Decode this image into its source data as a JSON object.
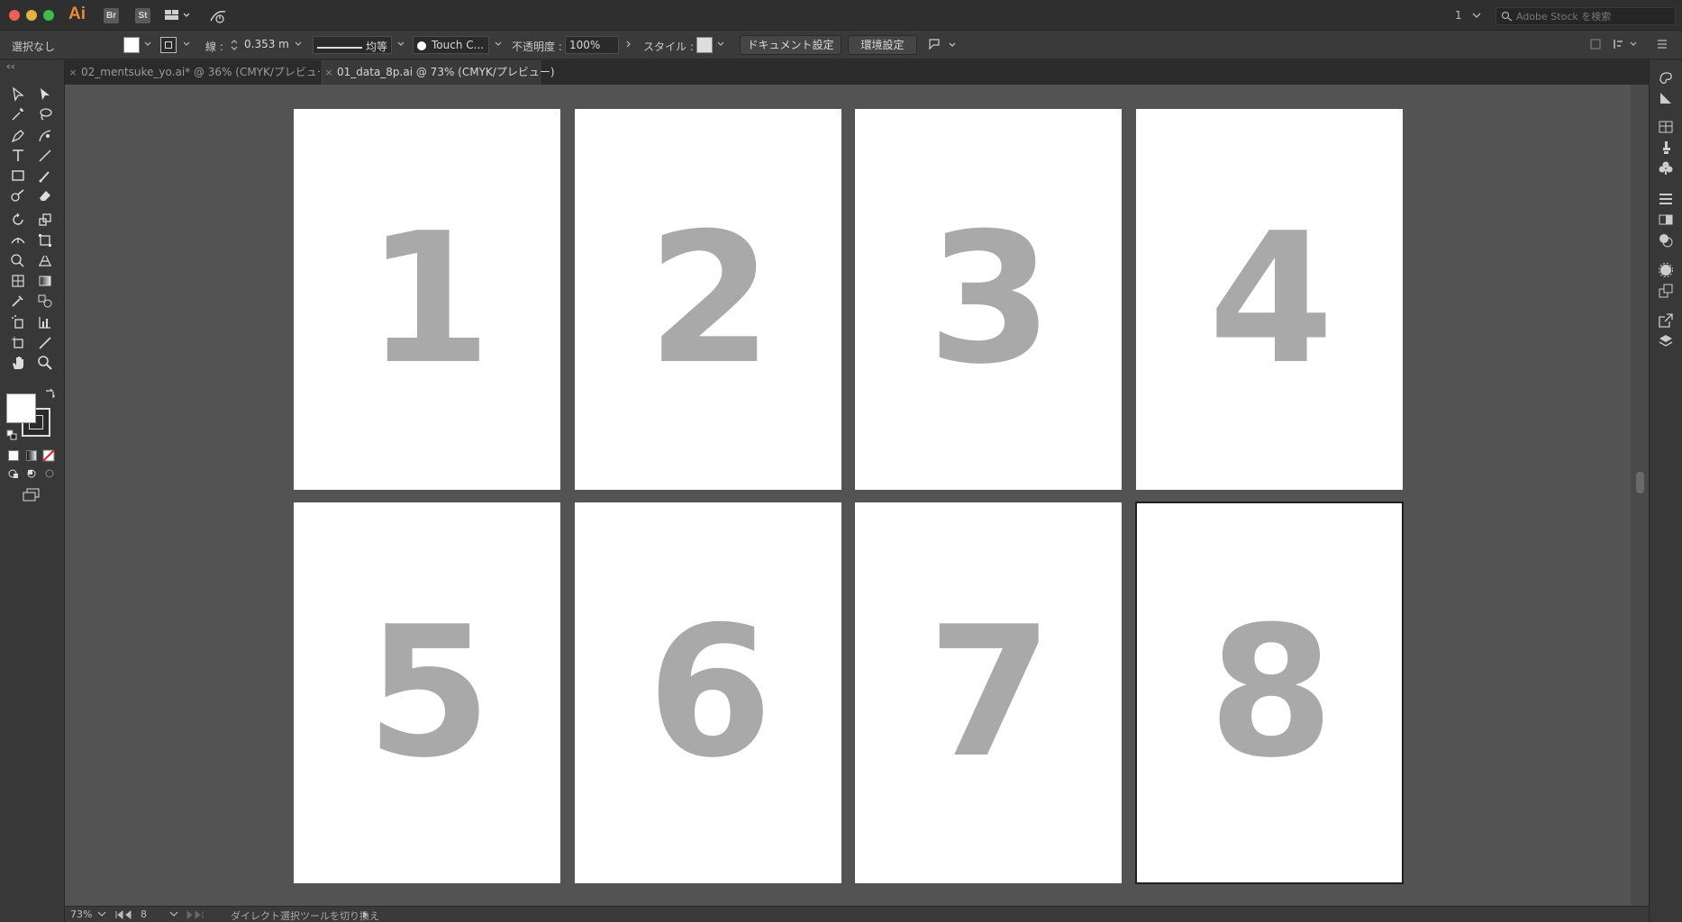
{
  "app": {
    "logo": "Ai",
    "bridge": "Br",
    "stock": "St",
    "page_counter": "1"
  },
  "search": {
    "placeholder": "Adobe Stock を検索"
  },
  "control_bar": {
    "selection": "選択なし",
    "stroke_label": "線 :",
    "stroke_weight": "0.353 m",
    "stroke_profile": "均等",
    "brush": "Touch C...",
    "opacity_label": "不透明度 :",
    "opacity_value": "100%",
    "style_label": "スタイル :",
    "doc_setup": "ドキュメント設定",
    "preferences": "環境設定"
  },
  "tabs": [
    {
      "label": "02_mentsuke_yo.ai* @ 36% (CMYK/プレビュー)",
      "active": false
    },
    {
      "label": "01_data_8p.ai @ 73% (CMYK/プレビュー)",
      "active": true
    }
  ],
  "artboards": [
    {
      "number": "1"
    },
    {
      "number": "2"
    },
    {
      "number": "3"
    },
    {
      "number": "4"
    },
    {
      "number": "5"
    },
    {
      "number": "6"
    },
    {
      "number": "7"
    },
    {
      "number": "8",
      "selected": true
    }
  ],
  "status": {
    "zoom": "73%",
    "artboard": "8",
    "tool_hint": "ダイレクト選択ツールを切り換え"
  },
  "colors": {
    "canvas": "#535353",
    "artboard": "#ffffff",
    "digits": "#a9a9a9",
    "app_accent": "#e48a3a"
  }
}
